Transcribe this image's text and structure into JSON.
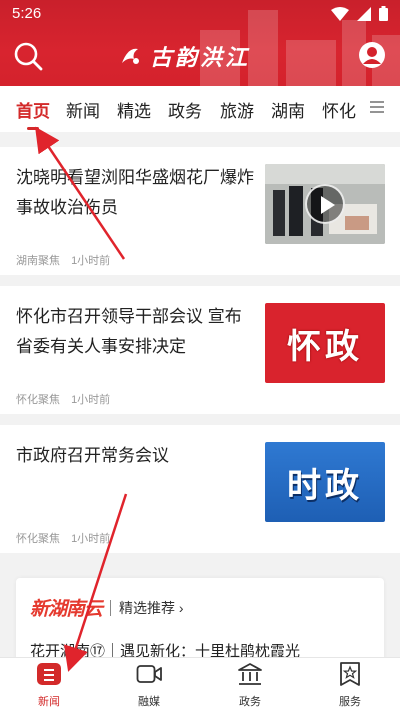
{
  "statusbar": {
    "time": "5:26"
  },
  "header": {
    "logo_text": "古韵洪江",
    "search_icon": "search-icon",
    "user_icon": "user-icon"
  },
  "tabs": [
    {
      "label": "首页",
      "active": true
    },
    {
      "label": "新闻"
    },
    {
      "label": "精选"
    },
    {
      "label": "政务"
    },
    {
      "label": "旅游"
    },
    {
      "label": "湖南"
    },
    {
      "label": "怀化"
    }
  ],
  "articles": [
    {
      "title": "沈晓明看望浏阳华盛烟花厂爆炸事故收治伤员",
      "source": "湖南聚焦",
      "time": "1小时前",
      "thumb": {
        "type": "video-photo"
      }
    },
    {
      "title": "怀化市召开领导干部会议 宣布省委有关人事安排决定",
      "source": "怀化聚焦",
      "time": "1小时前",
      "thumb": {
        "type": "label",
        "label": "怀政",
        "color": "#d9232d"
      }
    },
    {
      "title": "市政府召开常务会议",
      "source": "怀化聚焦",
      "time": "1小时前",
      "thumb": {
        "type": "label",
        "label": "时政",
        "color": "#2f79d2"
      }
    }
  ],
  "recommend": {
    "brand": "新湖南云",
    "link": "精选推荐 ›",
    "line": "花开湖南⑰｜遇见新化：十里杜鹃枕霞光"
  },
  "bottomnav": [
    {
      "label": "新闻",
      "icon": "news-icon",
      "active": true
    },
    {
      "label": "融媒",
      "icon": "video-camera-icon"
    },
    {
      "label": "政务",
      "icon": "government-building-icon"
    },
    {
      "label": "服务",
      "icon": "service-star-icon"
    }
  ],
  "colors": {
    "brand_red": "#d32a2a",
    "header_red": "#d4222c"
  }
}
